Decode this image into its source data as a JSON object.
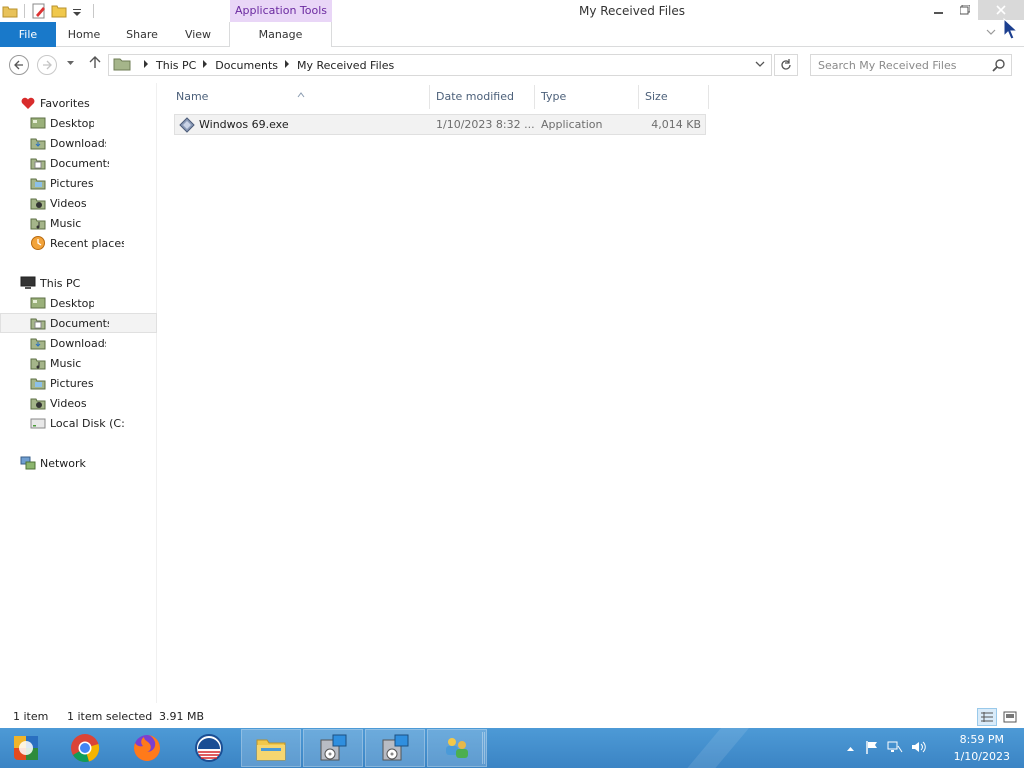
{
  "window": {
    "title": "My Received Files",
    "context_tab_header": "Application Tools"
  },
  "ribbon": {
    "tabs": [
      "File",
      "Home",
      "Share",
      "View",
      "Manage"
    ]
  },
  "address": {
    "crumbs": [
      "This PC",
      "Documents",
      "My Received Files"
    ]
  },
  "search": {
    "placeholder": "Search My Received Files"
  },
  "nav": {
    "favorites_header": "Favorites",
    "favorites": [
      "Desktop",
      "Downloads",
      "Documents",
      "Pictures",
      "Videos",
      "Music",
      "Recent places"
    ],
    "thispc_header": "This PC",
    "thispc": [
      "Desktop",
      "Documents",
      "Downloads",
      "Music",
      "Pictures",
      "Videos",
      "Local Disk (C:)"
    ],
    "network": "Network"
  },
  "columns": {
    "name": "Name",
    "date": "Date modified",
    "type": "Type",
    "size": "Size"
  },
  "files": [
    {
      "name": "Windwos 69.exe",
      "date": "1/10/2023 8:32 ...",
      "type": "Application",
      "size": "4,014 KB"
    }
  ],
  "status": {
    "count": "1 item",
    "selected": "1 item selected",
    "size": "3.91 MB"
  },
  "taskbar": {
    "time": "8:59 PM",
    "date": "1/10/2023"
  },
  "colors": {
    "file_tab": "#1979ca",
    "context_tab": "#e9d6f7",
    "taskbar": "#3b84c4"
  }
}
